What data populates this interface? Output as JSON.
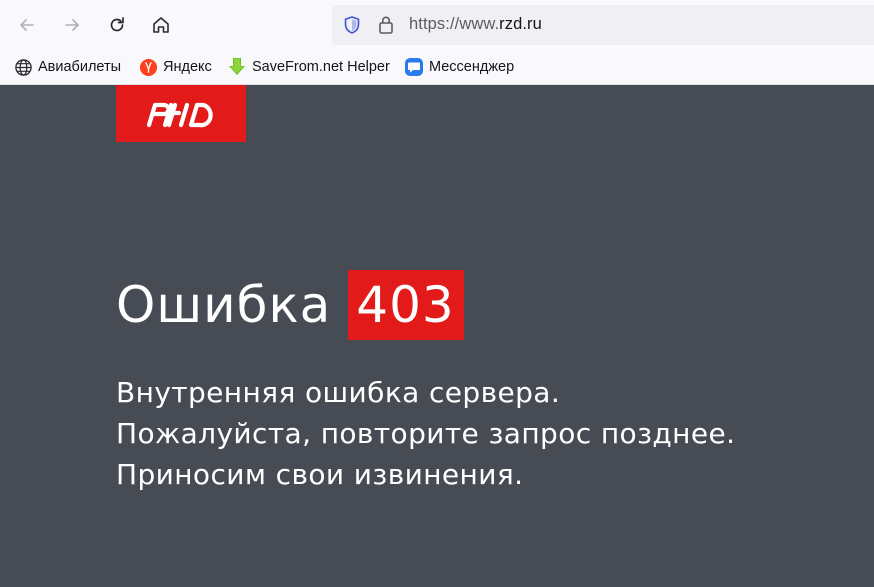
{
  "browser": {
    "url_prefix": "https://www.",
    "url_domain": "rzd.ru"
  },
  "bookmarks": [
    {
      "label": "Авиабилеты",
      "icon": "globe-icon"
    },
    {
      "label": "Яндекс",
      "icon": "yandex-icon"
    },
    {
      "label": "SaveFrom.net Helper",
      "icon": "download-arrow-icon"
    },
    {
      "label": "Мессенджер",
      "icon": "chat-bubble-icon"
    }
  ],
  "page": {
    "error_word": "Ошибка",
    "error_code": "403",
    "message_lines": [
      "Внутренняя ошибка сервера.",
      "Пожалуйста, повторите запрос позднее.",
      "Приносим свои извинения."
    ]
  },
  "colors": {
    "brand_red": "#e21a1a",
    "page_background": "#474b54"
  }
}
